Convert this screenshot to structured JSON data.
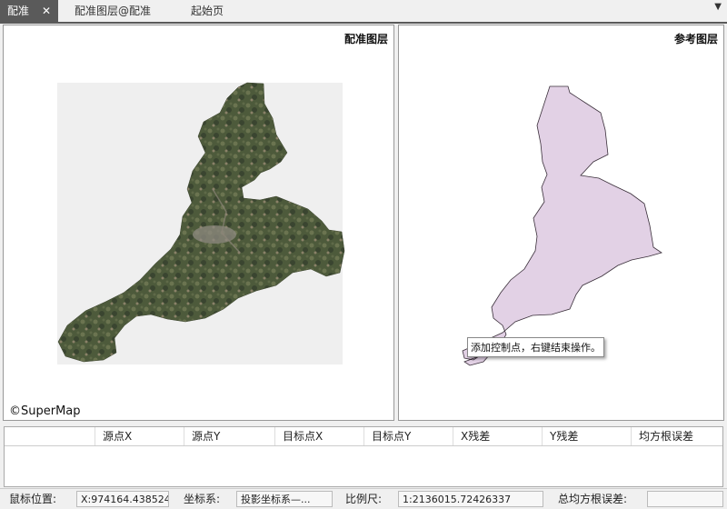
{
  "tabs": [
    {
      "label": "配准",
      "active": true,
      "close": "✕"
    },
    {
      "label": "配准图层@配准",
      "active": false
    },
    {
      "label": "起始页",
      "active": false
    }
  ],
  "tab_dropdown": "▼",
  "left_pane": {
    "title": "配准图层",
    "copyright": "©SuperMap",
    "map_type": "satellite-imagery"
  },
  "right_pane": {
    "title": "参考图层",
    "fill_color": "#e2d1e5"
  },
  "tooltip": "添加控制点，右键结束操作。",
  "grid": {
    "columns": [
      "",
      "源点X",
      "源点Y",
      "目标点X",
      "目标点Y",
      "X残差",
      "Y残差",
      "均方根误差"
    ]
  },
  "status": {
    "mouse_label": "鼠标位置:",
    "mouse_value": "X:974164.438524...",
    "coord_label": "坐标系:",
    "coord_value": "投影坐标系—...",
    "scale_label": "比例尺:",
    "scale_value": "1:2136015.72426337",
    "rmse_label": "总均方根误差:",
    "rmse_value": ""
  }
}
